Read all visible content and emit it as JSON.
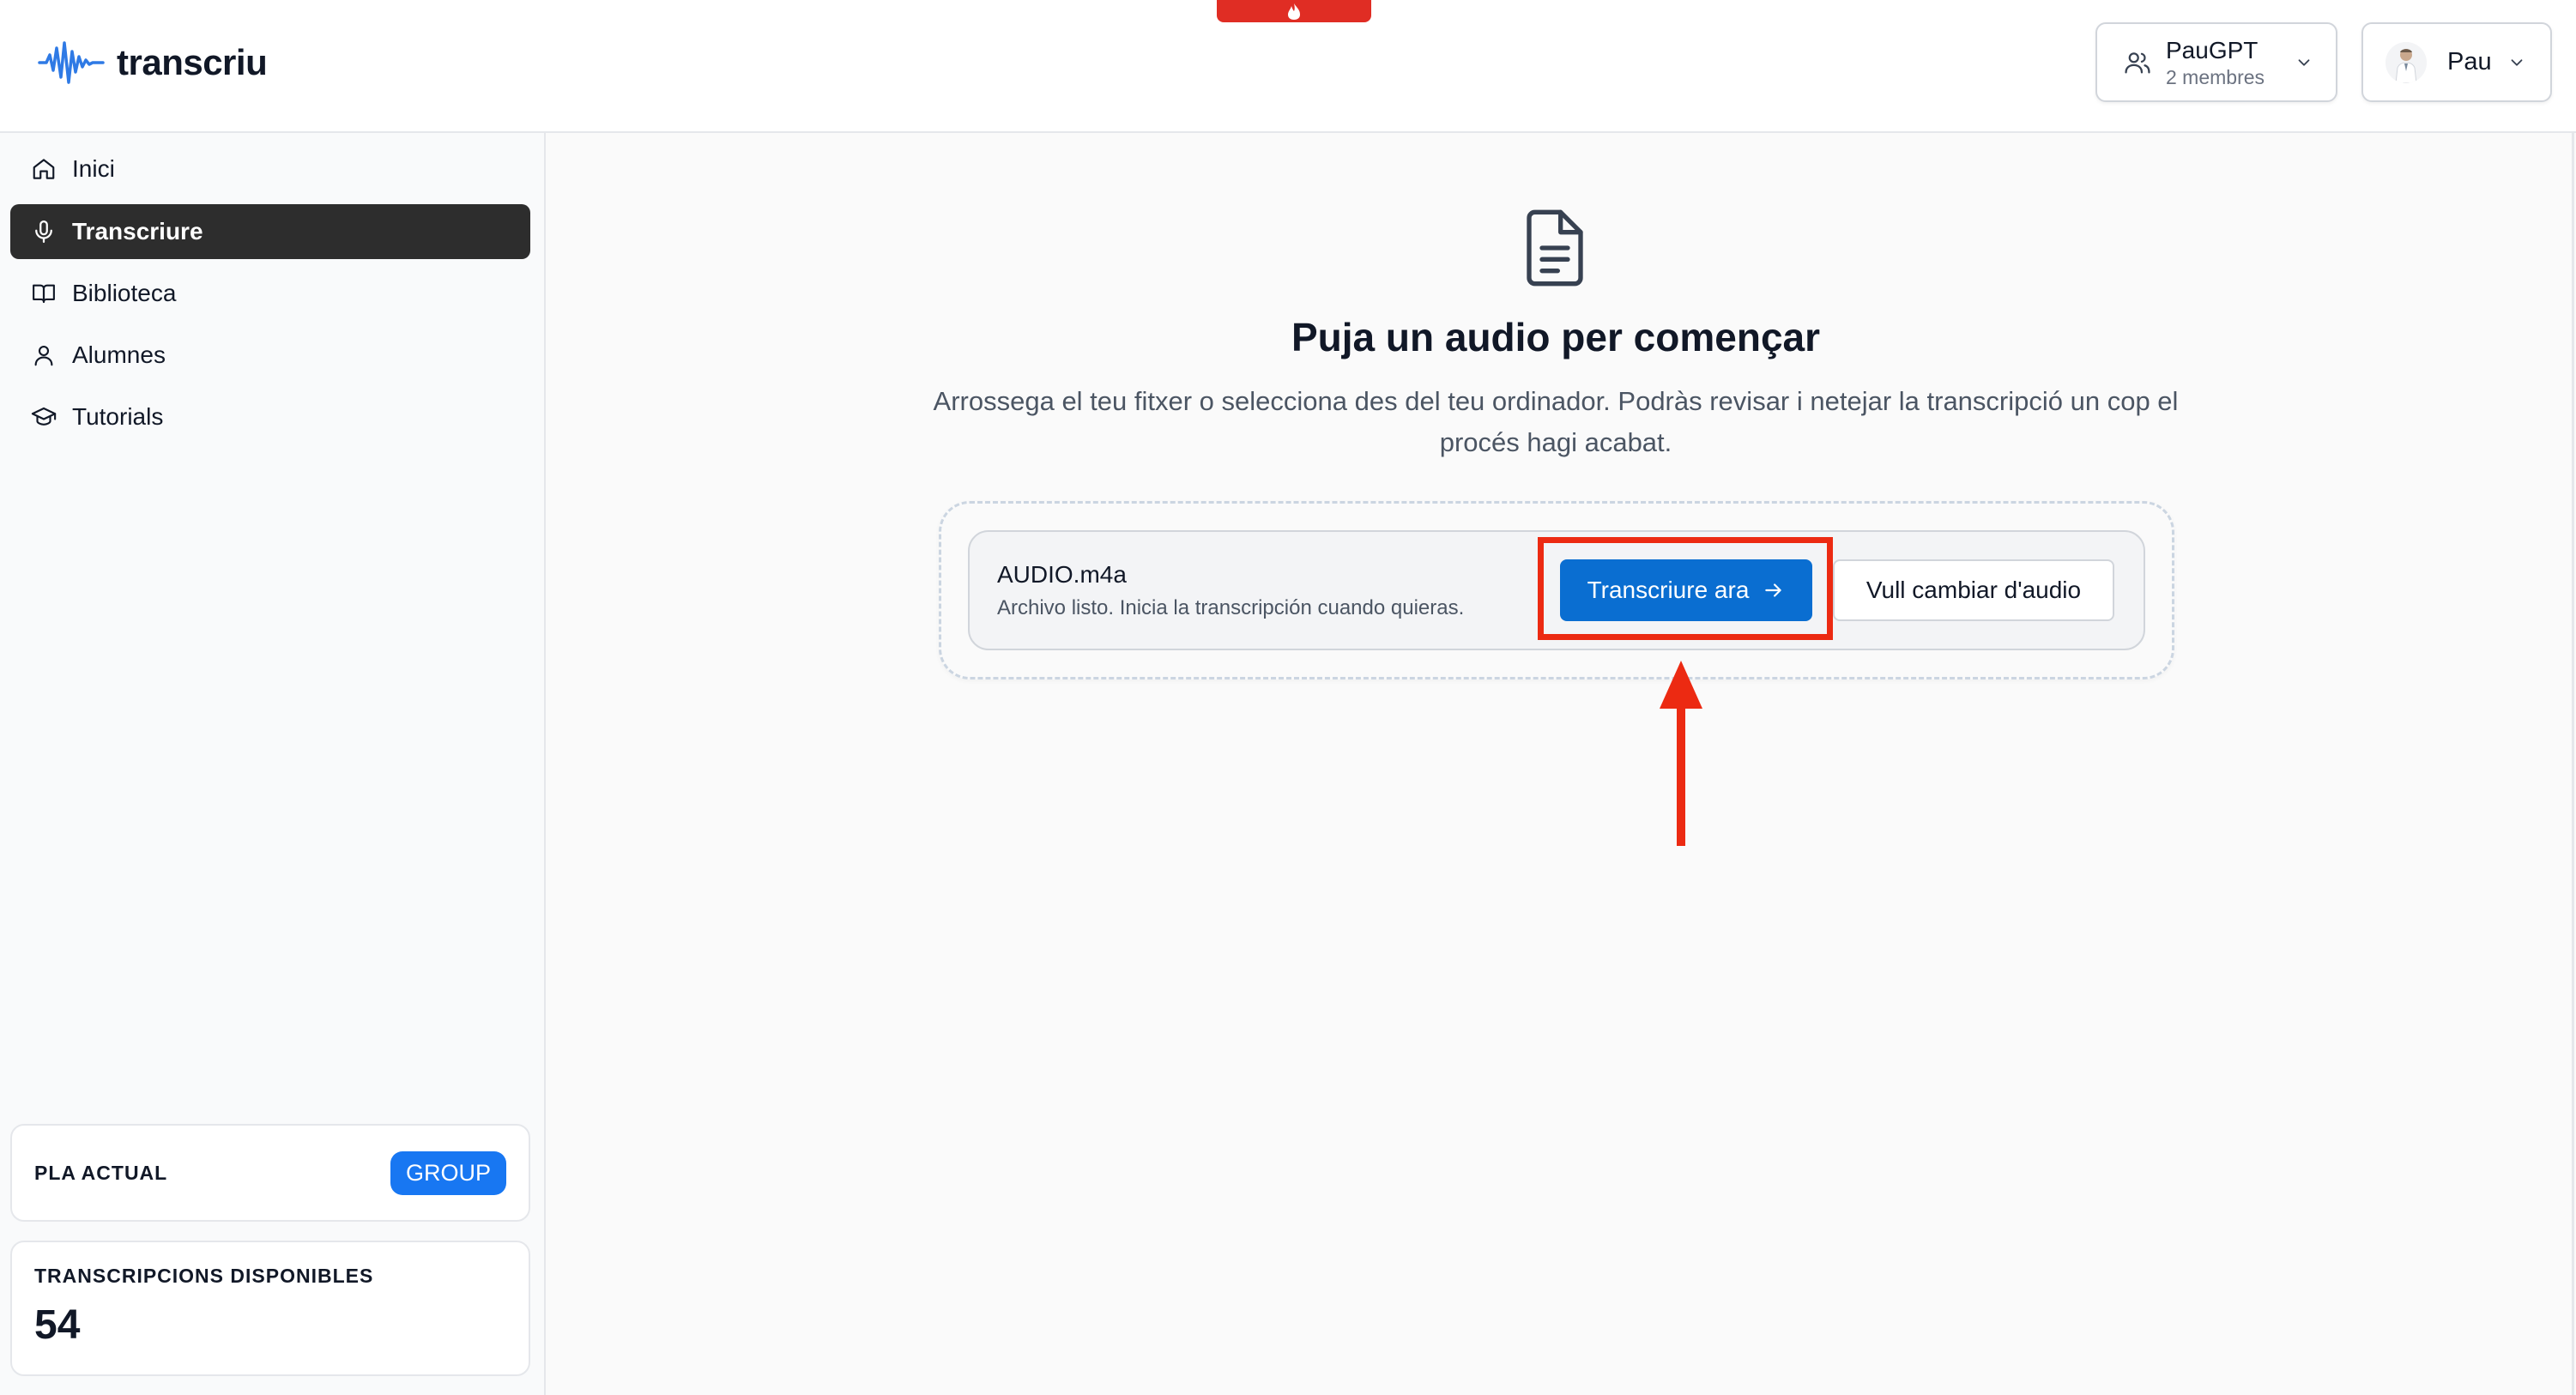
{
  "header": {
    "logo_text": "transcriu",
    "workspace": {
      "name": "PauGPT",
      "members": "2 membres"
    },
    "user": {
      "name": "Pau"
    }
  },
  "sidebar": {
    "items": [
      {
        "label": "Inici",
        "icon": "home-icon"
      },
      {
        "label": "Transcriure",
        "icon": "mic-icon",
        "active": true
      },
      {
        "label": "Biblioteca",
        "icon": "book-icon"
      },
      {
        "label": "Alumnes",
        "icon": "user-icon"
      },
      {
        "label": "Tutorials",
        "icon": "graduation-cap-icon"
      }
    ],
    "plan": {
      "label": "PLA ACTUAL",
      "badge": "GROUP"
    },
    "credits": {
      "label": "TRANSCRIPCIONS DISPONIBLES",
      "value": "54"
    }
  },
  "main": {
    "title": "Puja un audio per començar",
    "description": "Arrossega el teu fitxer o selecciona des del teu ordinador. Podràs revisar i netejar la transcripció un cop el procés hagi acabat.",
    "file": {
      "name": "AUDIO.m4a",
      "status": "Archivo listo. Inicia la transcripción cuando quieras."
    },
    "primary_button": "Transcriure ara",
    "secondary_button": "Vull cambiar d'audio"
  },
  "colors": {
    "primary": "#0a6ed1",
    "annotation": "#ec2a12",
    "sidebar_active": "#2d2d2d",
    "badge": "#1877f2"
  }
}
